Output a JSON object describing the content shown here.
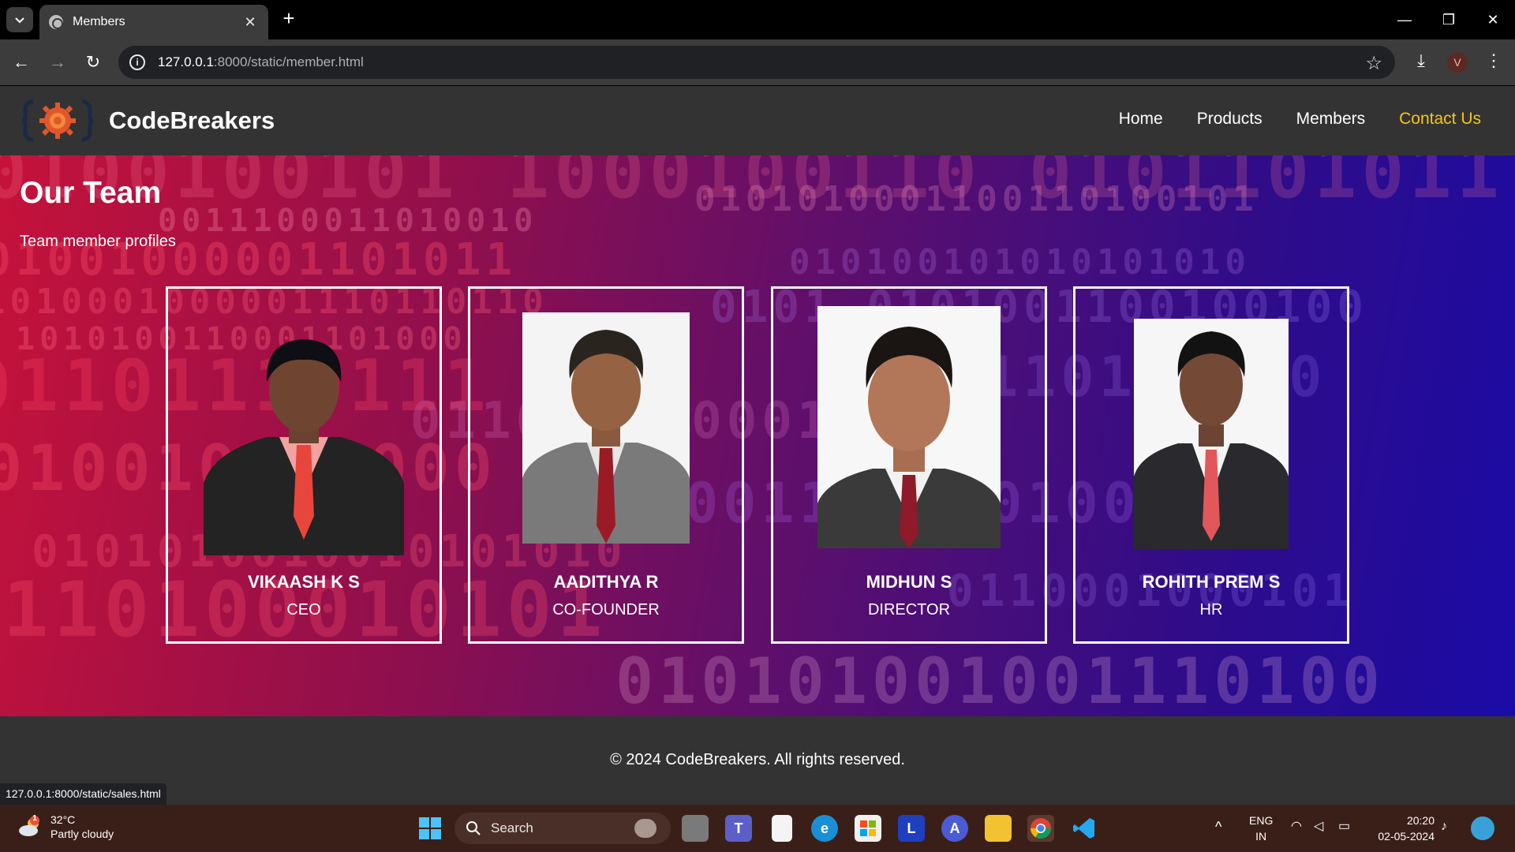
{
  "browser": {
    "tab_title": "Members",
    "url_host": "127.0.0.1",
    "url_rest": ":8000/static/member.html",
    "status_url": "127.0.0.1:8000/static/sales.html",
    "profile_initial": "V"
  },
  "site": {
    "brand": "CodeBreakers",
    "nav": [
      {
        "label": "Home",
        "active": false
      },
      {
        "label": "Products",
        "active": false
      },
      {
        "label": "Members",
        "active": false
      },
      {
        "label": "Contact Us",
        "active": true
      }
    ],
    "accent_color": "#f5c518"
  },
  "hero": {
    "title": "Our Team",
    "subtitle": "Team member profiles"
  },
  "members": [
    {
      "name": "VIKAASH K S",
      "role": "CEO"
    },
    {
      "name": "AADITHYA R",
      "role": "CO-FOUNDER"
    },
    {
      "name": "MIDHUN S",
      "role": "DIRECTOR"
    },
    {
      "name": "ROHITH PREM S",
      "role": "HR"
    }
  ],
  "footer": {
    "copyright": "© 2024 CodeBreakers. All rights reserved."
  },
  "taskbar": {
    "temperature": "32°C",
    "weather": "Partly cloudy",
    "weather_badge": "1",
    "search_label": "Search",
    "lang_top": "ENG",
    "lang_bottom": "IN",
    "time": "20:20",
    "date": "02-05-2024"
  }
}
